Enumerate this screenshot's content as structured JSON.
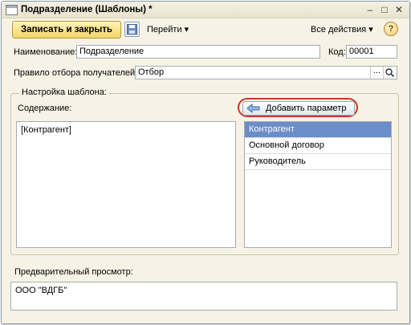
{
  "window": {
    "title": "Подразделение (Шаблоны) *"
  },
  "toolbar": {
    "save_close_label": "Записать и закрыть",
    "goto_label": "Перейти ▾",
    "all_actions_label": "Все действия ▾",
    "help_label": "?"
  },
  "form": {
    "name_label": "Наименование:",
    "name_value": "Подразделение",
    "code_label": "Код:",
    "code_value": "00001",
    "rule_label": "Правило отбора получателей:",
    "rule_value": "Отбор",
    "rule_dots": "..."
  },
  "template_group": {
    "caption": "Настройка шаблона:",
    "content_label": "Содержание:",
    "content_value": "[Контрагент]",
    "add_param_label": "Добавить параметр",
    "params": [
      "Контрагент",
      "Основной договор",
      "Руководитель"
    ],
    "selected_param_index": 0
  },
  "preview": {
    "label": "Предварительный просмотр:",
    "value": "ООО \"ВДГБ\""
  }
}
